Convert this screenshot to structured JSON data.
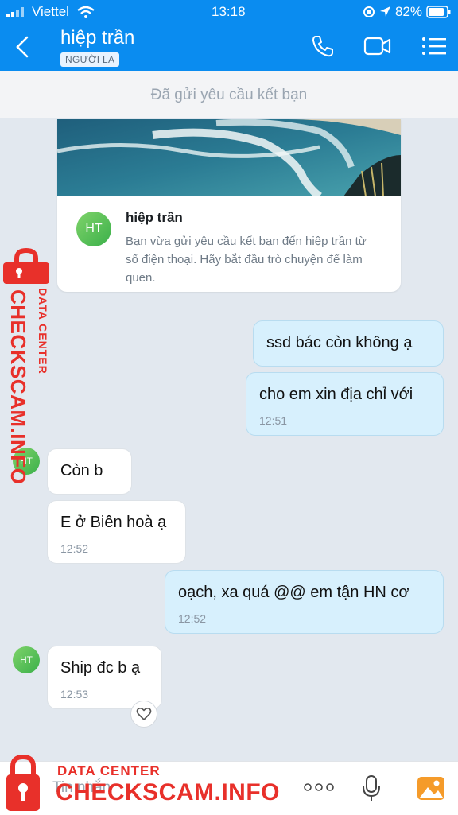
{
  "status_bar": {
    "carrier": "Viettel",
    "time": "13:18",
    "battery": "82%"
  },
  "header": {
    "title": "hiệp trần",
    "badge": "NGƯỜI LẠ",
    "icons": [
      "back-icon",
      "phone-icon",
      "video-icon",
      "menu-icon"
    ]
  },
  "notice": "Đã gửi yêu cầu kết bạn",
  "card": {
    "avatar": "HT",
    "name": "hiệp trần",
    "description": "Bạn vừa gửi yêu cầu kết bạn đến hiệp trần từ số điện thoại. Hãy bắt đầu trò chuyện để làm quen."
  },
  "messages": [
    {
      "side": "out",
      "text": "ssd bác còn không ạ",
      "time": ""
    },
    {
      "side": "out",
      "text": "cho em xin địa chỉ với",
      "time": "12:51"
    },
    {
      "side": "in",
      "text": "Còn b",
      "time": "",
      "avatar": "HT"
    },
    {
      "side": "in",
      "text": "E ở Biên hoà ạ",
      "time": "12:52"
    },
    {
      "side": "out",
      "text": "oạch, xa quá @@ em tận HN cơ",
      "time": "12:52"
    },
    {
      "side": "in",
      "text": "Ship đc b ạ",
      "time": "12:53",
      "avatar": "HT"
    }
  ],
  "composer": {
    "placeholder": "Tin nhắn",
    "icons": [
      "more-icon",
      "mic-icon",
      "image-icon"
    ]
  },
  "watermark": {
    "line1": "DATA CENTER",
    "line2": "CHECKSCAM.INFO"
  },
  "colors": {
    "header": "#0a8cf0",
    "outgoing_bubble": "#d7f0fd",
    "incoming_bubble": "#ffffff",
    "watermark": "#e8302a"
  }
}
